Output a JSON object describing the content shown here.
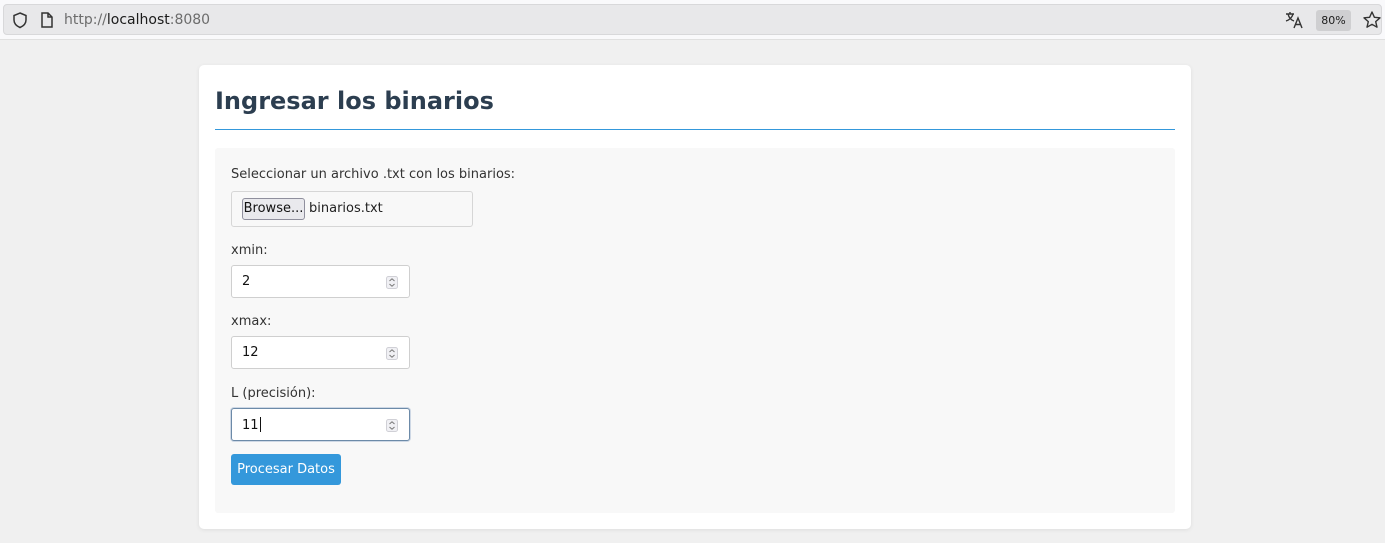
{
  "browser": {
    "url_protocol": "http://",
    "url_host": "localhost",
    "url_port": ":8080",
    "zoom": "80%"
  },
  "page": {
    "title": "Ingresar los binarios",
    "file_label": "Seleccionar un archivo .txt con los binarios:",
    "file_button": "Browse...",
    "file_name": "binarios.txt",
    "xmin_label": "xmin:",
    "xmin_value": "2",
    "xmax_label": "xmax:",
    "xmax_value": "12",
    "l_label": "L (precisión):",
    "l_value": "11",
    "submit_label": "Procesar Datos"
  },
  "colors": {
    "accent": "#3498db",
    "title": "#2c3e50"
  }
}
